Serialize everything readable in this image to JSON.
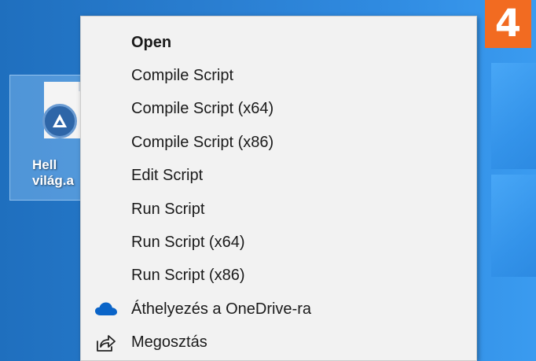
{
  "desktop": {
    "icon": {
      "name": "autoit-script-file",
      "label_line1": "Hell",
      "label_line2": "világ.a"
    }
  },
  "step_badge": "4",
  "context_menu": {
    "items": [
      {
        "label": "Open",
        "bold": true,
        "icon": ""
      },
      {
        "label": "Compile Script",
        "bold": false,
        "icon": ""
      },
      {
        "label": "Compile Script (x64)",
        "bold": false,
        "icon": ""
      },
      {
        "label": "Compile Script (x86)",
        "bold": false,
        "icon": ""
      },
      {
        "label": "Edit Script",
        "bold": false,
        "icon": ""
      },
      {
        "label": "Run Script",
        "bold": false,
        "icon": ""
      },
      {
        "label": "Run Script (x64)",
        "bold": false,
        "icon": ""
      },
      {
        "label": "Run Script (x86)",
        "bold": false,
        "icon": ""
      },
      {
        "label": "Áthelyezés a OneDrive-ra",
        "bold": false,
        "icon": "onedrive-cloud-icon"
      },
      {
        "label": "Megosztás",
        "bold": false,
        "icon": "share-icon"
      }
    ]
  },
  "colors": {
    "badge": "#f26b21",
    "menu_bg": "#f2f2f2",
    "onedrive": "#0a64c8"
  }
}
